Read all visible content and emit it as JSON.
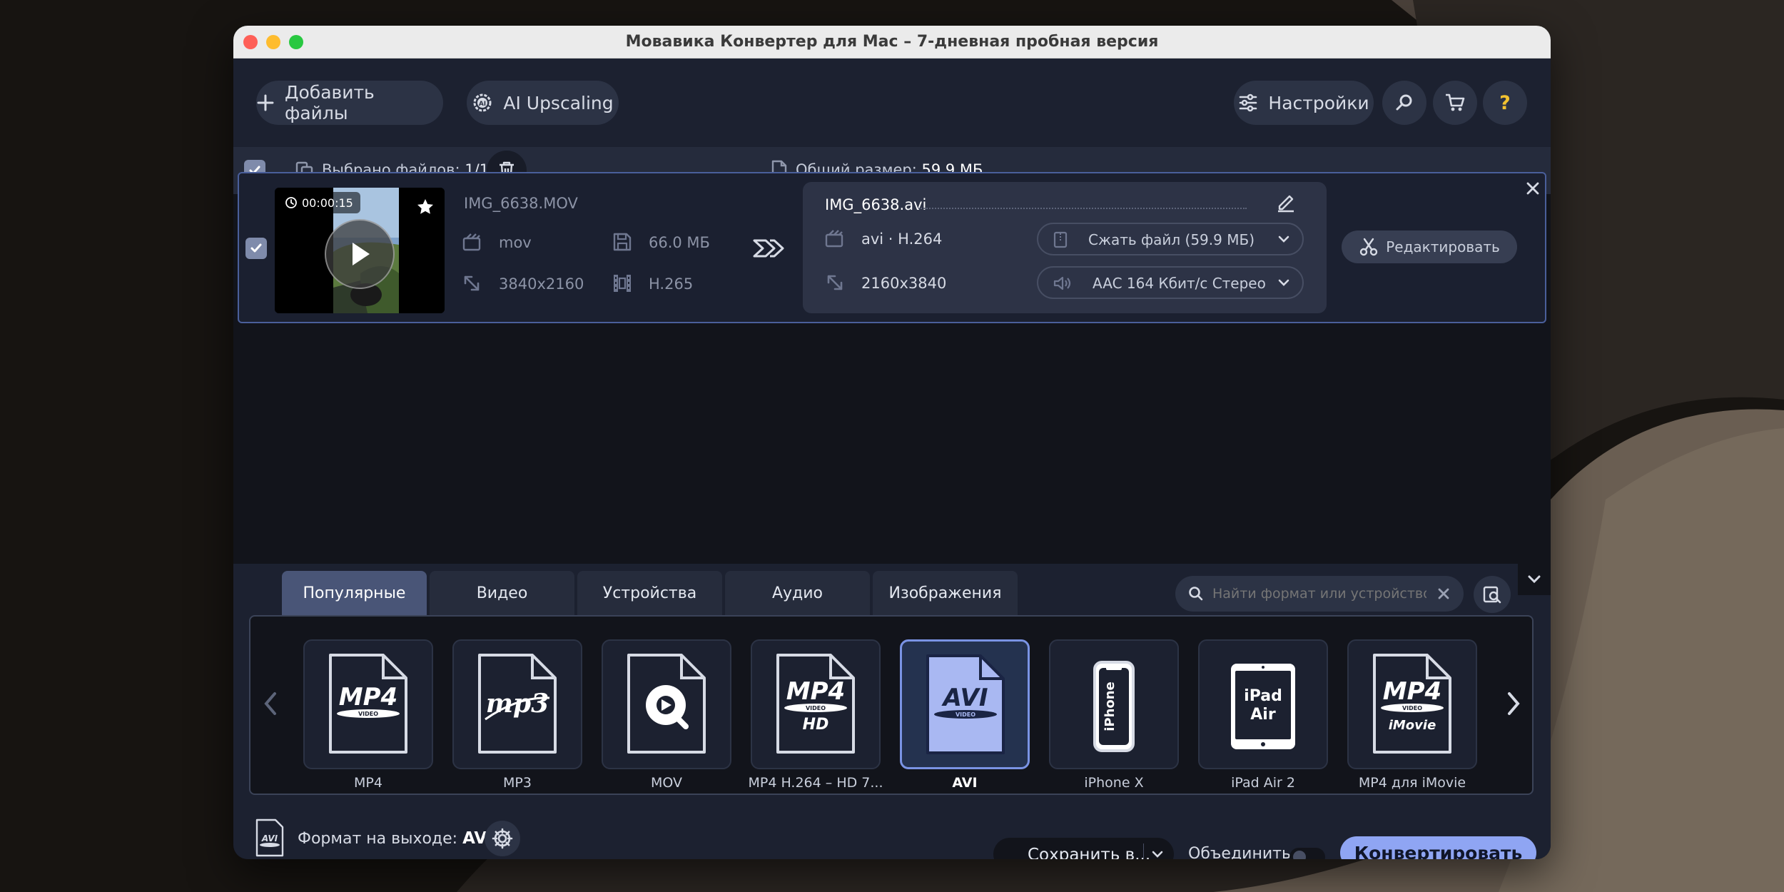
{
  "window": {
    "title": "Мовавика Конвертер для Mac – 7-дневная пробная версия"
  },
  "toolbar": {
    "add_files": "Добавить файлы",
    "ai_upscaling": "AI Upscaling",
    "settings": "Настройки"
  },
  "selection": {
    "selected_label": "Выбрано файлов:",
    "selected_value": "1/1",
    "total_size_label": "Общий размер:",
    "total_size_value": "59.9 МБ"
  },
  "file": {
    "duration": "00:00:15",
    "source_name": "IMG_6638.MOV",
    "source_format": "mov",
    "source_size": "66.0 МБ",
    "source_resolution": "3840x2160",
    "source_codec": "H.265",
    "output_name": "IMG_6638.avi",
    "output_format": "avi · H.264",
    "output_resolution": "2160x3840",
    "compress": "Сжать файл (59.9 МБ)",
    "audio": "AAC 164 Кбит/с Стерео",
    "edit": "Редактировать"
  },
  "tabs": [
    "Популярные",
    "Видео",
    "Устройства",
    "Аудио",
    "Изображения"
  ],
  "search": {
    "placeholder": "Найти формат или устройство..."
  },
  "formats": [
    {
      "label": "MP4",
      "icon": "MP4",
      "sub": "VIDEO",
      "kind": "doc"
    },
    {
      "label": "MP3",
      "icon": "mp3",
      "sub": "",
      "kind": "doc"
    },
    {
      "label": "MOV",
      "icon": "",
      "sub": "",
      "kind": "quicktime"
    },
    {
      "label": "MP4 H.264 – HD 7...",
      "icon": "MP4",
      "sub": "VIDEO",
      "sub2": "HD",
      "kind": "doc"
    },
    {
      "label": "AVI",
      "icon": "AVI",
      "sub": "VIDEO",
      "kind": "doc"
    },
    {
      "label": "iPhone X",
      "icon": "iPhone",
      "sub": "",
      "kind": "phone"
    },
    {
      "label": "iPad Air 2",
      "icon": "iPad",
      "sub": "Air",
      "kind": "tablet"
    },
    {
      "label": "MP4 для iMovie",
      "icon": "MP4",
      "sub": "VIDEO",
      "sub2": "iMovie",
      "kind": "doc"
    }
  ],
  "selected_format_index": 4,
  "footer": {
    "output_format_label": "Формат на выходе:",
    "output_format_value": "AVI",
    "format_icon_text": "AVI",
    "save_to": "Сохранить в...",
    "merge_label": "Объединить:",
    "merge_on": false,
    "convert": "Конвертировать"
  },
  "colors": {
    "accent": "#8fa5f3",
    "panel": "#1c2130",
    "selected_tile": "#a9b8f2"
  }
}
